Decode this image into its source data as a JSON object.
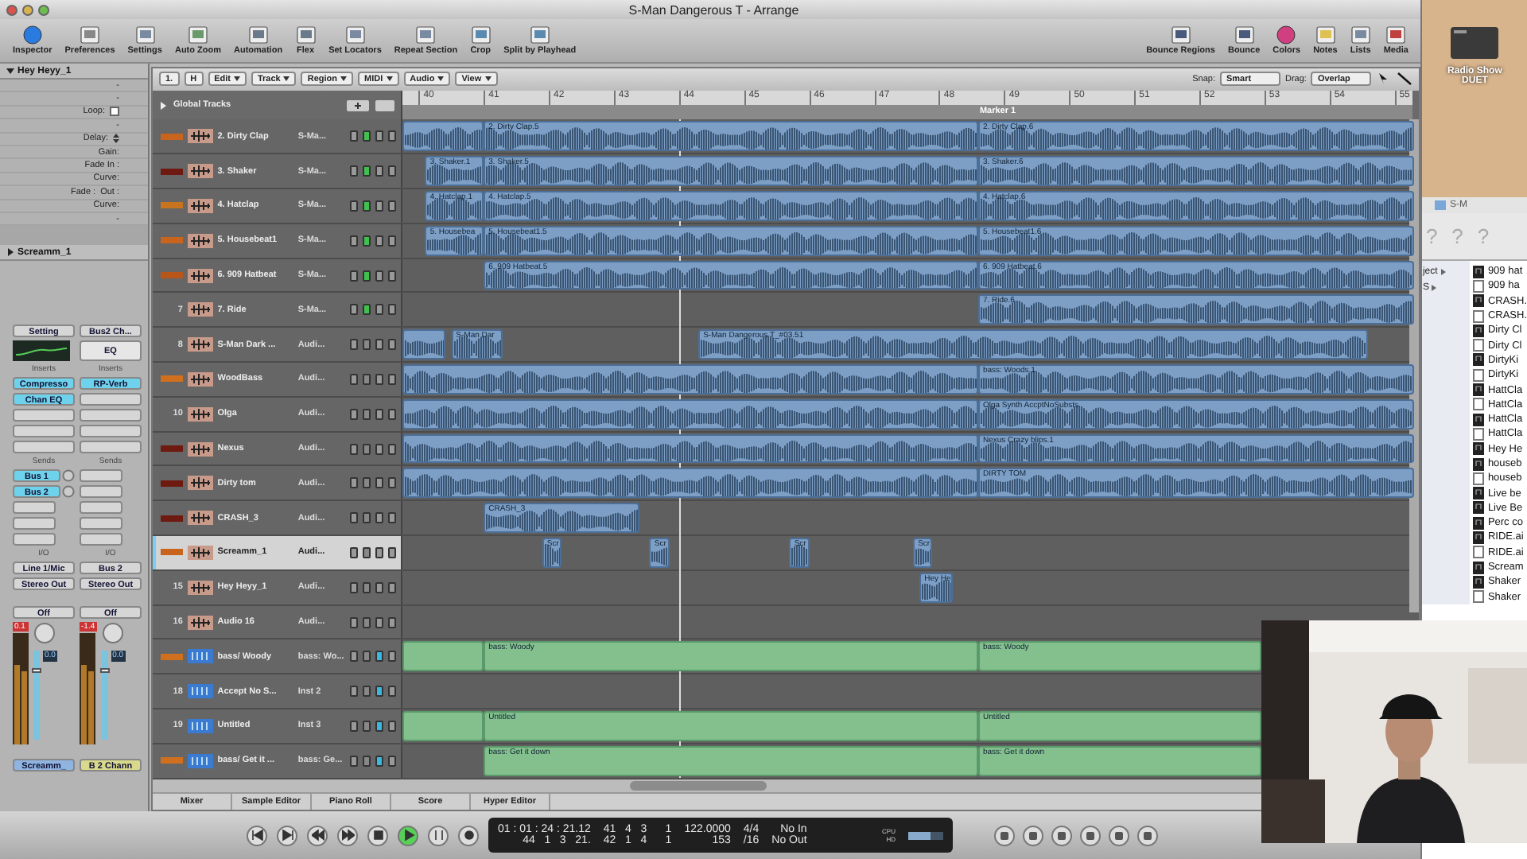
{
  "window": {
    "title": "S-Man Dangerous T - Arrange"
  },
  "toolbar": {
    "left": [
      {
        "label": "Inspector",
        "kind": "info"
      },
      {
        "label": "Preferences",
        "kind": "switch"
      },
      {
        "label": "Settings",
        "kind": "doc"
      },
      {
        "label": "Auto Zoom",
        "kind": "zoom"
      },
      {
        "label": "Automation",
        "kind": "panel"
      },
      {
        "label": "Flex",
        "kind": "panel"
      },
      {
        "label": "Set Locators",
        "kind": "doc"
      },
      {
        "label": "Repeat Section",
        "kind": "doc"
      },
      {
        "label": "Crop",
        "kind": "scissors"
      },
      {
        "label": "Split by Playhead",
        "kind": "scissors"
      }
    ],
    "right": [
      {
        "label": "Bounce Regions",
        "kind": "bounce"
      },
      {
        "label": "Bounce",
        "kind": "bounce"
      },
      {
        "label": "Colors",
        "kind": "wheel"
      },
      {
        "label": "Notes",
        "kind": "notes"
      },
      {
        "label": "Lists",
        "kind": "doc"
      },
      {
        "label": "Media",
        "kind": "media"
      }
    ]
  },
  "inspector": {
    "region_title": "Hey Heyy_1",
    "region_expanded": true,
    "params": [
      {
        "kind": "text",
        "label": "-"
      },
      {
        "kind": "text",
        "label": "-"
      },
      {
        "kind": "checkbox",
        "label": "Loop:",
        "checked": false
      },
      {
        "kind": "text",
        "label": "-"
      },
      {
        "kind": "stepper",
        "label": "Delay:"
      },
      {
        "kind": "text",
        "label": "Gain:"
      },
      {
        "kind": "text",
        "label": "Fade In :"
      },
      {
        "kind": "text",
        "label": "Curve:"
      },
      {
        "kind": "text",
        "label": "Fade :",
        "value": "Out :"
      },
      {
        "kind": "text",
        "label": "Curve:"
      },
      {
        "kind": "text",
        "label": "-"
      }
    ],
    "track_title": "Screamm_1",
    "track_expanded": false,
    "strips": [
      {
        "setting": "Setting",
        "inserts_label": "Inserts",
        "inserts": [
          "Compresso",
          "Chan EQ"
        ],
        "sends_label": "Sends",
        "sends": [
          "Bus 1",
          "Bus 2"
        ],
        "io_label": "I/O",
        "input": "Line 1/Mic",
        "output": "Stereo Out",
        "automation": "Off",
        "peak": "0.1",
        "fader": "0.0",
        "level": 0.8,
        "name": "Screamm_",
        "color": "#8fb4e0"
      },
      {
        "setting": "Bus2 Ch...",
        "eq": "EQ",
        "inserts_label": "Inserts",
        "inserts": [
          "RP-Verb"
        ],
        "sends_label": "Sends",
        "io_label": "I/O",
        "input": "Bus 2",
        "output": "Stereo Out",
        "automation": "Off",
        "peak": "-1.4",
        "fader": "0.0",
        "level": 0.8,
        "name": "B 2 Chann",
        "color": "#d9d98e"
      }
    ]
  },
  "arrange": {
    "tools": [
      "1.",
      "H"
    ],
    "menus": [
      "Edit",
      "Track",
      "Region",
      "MIDI",
      "Audio",
      "View"
    ],
    "snap_label": "Snap:",
    "snap": "Smart",
    "drag_label": "Drag:",
    "drag": "Overlap",
    "global_tracks": "Global Tracks",
    "global_expanded": false,
    "ruler": [
      "40",
      "41",
      "42",
      "43",
      "44",
      "45",
      "46",
      "47",
      "48",
      "49",
      "50",
      "51",
      "52",
      "53",
      "54",
      "55"
    ],
    "marker": "Marker 1",
    "tracks": [
      {
        "kind": "audio",
        "color": "#c8641e",
        "name": "2. Dirty Clap",
        "channel": "S-Ma...",
        "armed": true,
        "selected": false,
        "regions": [
          {
            "kind": "audio"
          },
          {
            "kind": "audio",
            "label": "2. Dirty Clap.5"
          },
          {
            "kind": "audio",
            "label": "2. Dirty Clap.6"
          }
        ]
      },
      {
        "kind": "audio",
        "color": "#6e1a10",
        "name": "3. Shaker",
        "channel": "S-Ma...",
        "armed": true,
        "selected": false,
        "regions": [
          {
            "kind": "audio",
            "label": "3. Shaker.1"
          },
          {
            "kind": "audio",
            "label": "3. Shaker.5"
          },
          {
            "kind": "audio",
            "label": "3. Shaker.6"
          }
        ]
      },
      {
        "kind": "audio",
        "color": "#c8741e",
        "name": "4. Hatclap",
        "channel": "S-Ma...",
        "armed": true,
        "selected": false,
        "regions": [
          {
            "kind": "audio",
            "label": "4. Hatclap.1"
          },
          {
            "kind": "audio",
            "label": "4. Hatclap.5"
          },
          {
            "kind": "audio",
            "label": "4. Hatclap.6"
          }
        ]
      },
      {
        "kind": "audio",
        "color": "#c8641e",
        "name": "5. Housebeat1",
        "channel": "S-Ma...",
        "armed": true,
        "selected": false,
        "regions": [
          {
            "kind": "audio",
            "label": "5. Housebea"
          },
          {
            "kind": "audio",
            "label": "5. Housebeat1.5"
          },
          {
            "kind": "audio",
            "label": "5. Housebeat1.6"
          }
        ]
      },
      {
        "kind": "audio",
        "color": "#b8561a",
        "name": "6. 909 Hatbeat",
        "channel": "S-Ma...",
        "armed": true,
        "selected": false,
        "regions": [
          {
            "kind": "audio",
            "label": "6. 909 Hatbeat.5"
          },
          {
            "kind": "audio",
            "label": "6. 909 Hatbeat.6"
          }
        ]
      },
      {
        "kind": "audio",
        "number": "7",
        "name": "7. Ride",
        "channel": "S-Ma...",
        "armed": true,
        "selected": false,
        "regions": [
          {
            "kind": "audio",
            "label": "7. Ride.6"
          }
        ]
      },
      {
        "kind": "audio",
        "number": "8",
        "name": "S-Man Dark ...",
        "channel": "Audi...",
        "armed": false,
        "selected": false,
        "regions": [
          {
            "kind": "audio"
          },
          {
            "kind": "audio",
            "label": "S-Man Dar"
          },
          {
            "kind": "audio",
            "label": "S-Man Dangerous T_#03.51"
          }
        ]
      },
      {
        "kind": "audio",
        "color": "#d0701e",
        "name": "WoodBass",
        "channel": "Audi...",
        "armed": false,
        "selected": false,
        "regions": [
          {
            "kind": "audio"
          },
          {
            "kind": "audio",
            "label": "bass: Woods.1"
          }
        ]
      },
      {
        "kind": "audio",
        "number": "10",
        "name": "Olga",
        "channel": "Audi...",
        "armed": false,
        "selected": false,
        "regions": [
          {
            "kind": "audio"
          },
          {
            "kind": "audio",
            "label": "Olga Synth AccptNoSubsts"
          }
        ]
      },
      {
        "kind": "audio",
        "color": "#6e1a10",
        "name": "Nexus",
        "channel": "Audi...",
        "armed": false,
        "selected": false,
        "regions": [
          {
            "kind": "audio"
          },
          {
            "kind": "audio",
            "label": "Nexus Crazy blips.1"
          }
        ]
      },
      {
        "kind": "audio",
        "color": "#6e1a10",
        "name": "Dirty tom",
        "channel": "Audi...",
        "armed": false,
        "selected": false,
        "regions": [
          {
            "kind": "audio"
          },
          {
            "kind": "audio",
            "label": "DIRTY TOM"
          }
        ]
      },
      {
        "kind": "audio",
        "color": "#6e1a10",
        "name": "CRASH_3",
        "channel": "Audi...",
        "armed": false,
        "selected": false,
        "regions": [
          {
            "kind": "audio",
            "label": "CRASH_3"
          }
        ]
      },
      {
        "kind": "audio",
        "color": "#c8641e",
        "name": "Screamm_1",
        "channel": "Audi...",
        "armed": false,
        "selected": true,
        "regions": [
          {
            "kind": "audio",
            "label": "Scr"
          },
          {
            "kind": "audio",
            "label": "Scr"
          },
          {
            "kind": "audio",
            "label": "Scr"
          },
          {
            "kind": "audio",
            "label": "Scr"
          }
        ]
      },
      {
        "kind": "audio",
        "number": "15",
        "name": "Hey Heyy_1",
        "channel": "Audi...",
        "armed": false,
        "selected": false,
        "regions": [
          {
            "kind": "audio",
            "label": "Hey He"
          }
        ]
      },
      {
        "kind": "audio",
        "number": "16",
        "name": "Audio 16",
        "channel": "Audi...",
        "armed": false,
        "selected": false
      },
      {
        "kind": "midi",
        "color": "#d0701e",
        "name": "bass/ Woody",
        "channel": "bass: Wo...",
        "armed": false,
        "selected": false,
        "regions": [
          {
            "kind": "midi"
          },
          {
            "kind": "midi",
            "label": "bass: Woody"
          },
          {
            "kind": "midi",
            "label": "bass: Woody"
          }
        ]
      },
      {
        "kind": "midi",
        "number": "18",
        "name": "Accept No S...",
        "channel": "Inst 2",
        "armed": false,
        "selected": false
      },
      {
        "kind": "midi",
        "number": "19",
        "name": "Untitled",
        "channel": "Inst 3",
        "armed": false,
        "selected": false,
        "regions": [
          {
            "kind": "midi"
          },
          {
            "kind": "midi",
            "label": "Untitled"
          },
          {
            "kind": "midi",
            "label": "Untitled"
          }
        ]
      },
      {
        "kind": "midi",
        "color": "#d0701e",
        "name": "bass/ Get it ...",
        "channel": "bass: Ge...",
        "armed": false,
        "selected": false,
        "regions": [
          {
            "kind": "midi",
            "label": "bass: Get it down"
          },
          {
            "kind": "midi",
            "label": "bass: Get it down"
          }
        ]
      }
    ],
    "tabs": [
      "Mixer",
      "Sample Editor",
      "Piano Roll",
      "Score",
      "Hyper Editor"
    ]
  },
  "transport": {
    "buttons": [
      {
        "kind": "start"
      },
      {
        "kind": "end"
      },
      {
        "kind": "rewind"
      },
      {
        "kind": "forward"
      },
      {
        "kind": "stop"
      },
      {
        "kind": "play",
        "on": true
      },
      {
        "kind": "pause"
      },
      {
        "kind": "record"
      }
    ],
    "lcd": [
      [
        "01 : 01 : 24 : 21.12",
        "44   1   3   21."
      ],
      [
        "41   4   3      1",
        "42   1   4      1"
      ],
      [
        "122.0000",
        "153"
      ],
      [
        "4/4",
        "/16"
      ],
      [
        "No In",
        "No Out"
      ]
    ],
    "cpu": "CPU",
    "hd": "HD"
  },
  "desktop": {
    "icon_label": "Radio Show DUET",
    "finder": {
      "title": "S-M",
      "buttons": [
        "?",
        "?",
        "?"
      ],
      "sidebar": [
        "ject",
        "S"
      ],
      "files": [
        {
          "kind": "audio",
          "name": "909 hat"
        },
        {
          "kind": "doc",
          "name": "909 ha"
        },
        {
          "kind": "audio",
          "name": "CRASH."
        },
        {
          "kind": "doc",
          "name": "CRASH."
        },
        {
          "kind": "audio",
          "name": "Dirty Cl"
        },
        {
          "kind": "doc",
          "name": "Dirty Cl"
        },
        {
          "kind": "audio",
          "name": "DirtyKi"
        },
        {
          "kind": "doc",
          "name": "DirtyKi"
        },
        {
          "kind": "audio",
          "name": "HattCla"
        },
        {
          "kind": "doc",
          "name": "HattCla"
        },
        {
          "kind": "audio",
          "name": "HattCla"
        },
        {
          "kind": "doc",
          "name": "HattCla"
        },
        {
          "kind": "audio",
          "name": "Hey He"
        },
        {
          "kind": "audio",
          "name": "houseb"
        },
        {
          "kind": "doc",
          "name": "houseb"
        },
        {
          "kind": "audio",
          "name": "Live be"
        },
        {
          "kind": "audio",
          "name": "Live Be"
        },
        {
          "kind": "audio",
          "name": "Perc co"
        },
        {
          "kind": "audio",
          "name": "RIDE.ai"
        },
        {
          "kind": "doc",
          "name": "RIDE.ai"
        },
        {
          "kind": "audio",
          "name": "Scream"
        },
        {
          "kind": "audio",
          "name": "Shaker"
        },
        {
          "kind": "doc",
          "name": "Shaker"
        }
      ]
    }
  }
}
